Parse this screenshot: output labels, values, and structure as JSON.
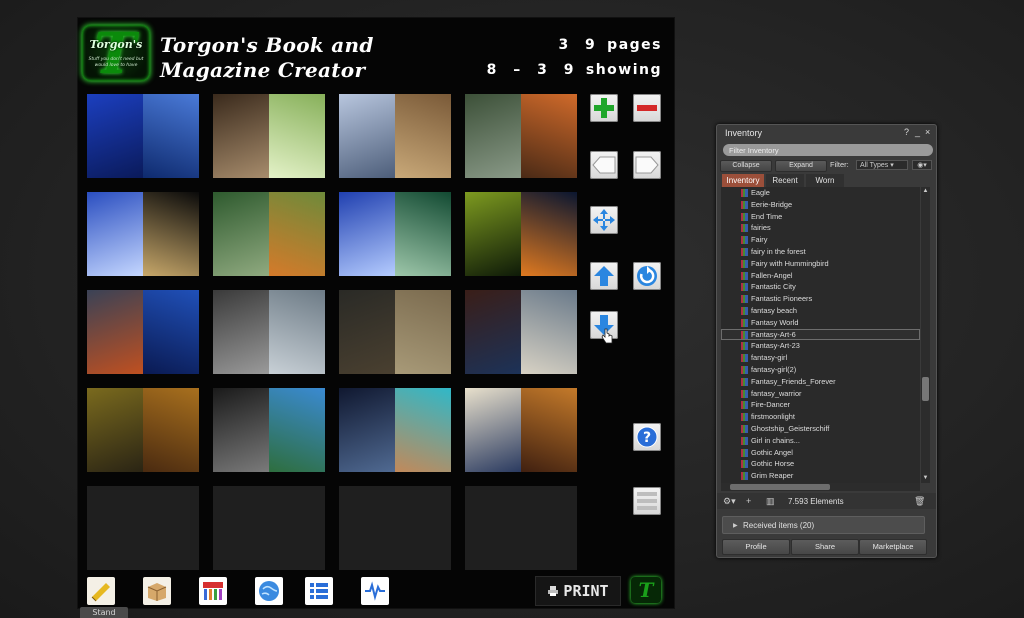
{
  "hud": {
    "logo_brand": "Torgon's",
    "logo_tagline": "Stuff you don't need but would love to have",
    "title_line1": "Torgon's Book and",
    "title_line2": "Magazine Creator",
    "pages_count": "3 9",
    "pages_label": "pages",
    "showing_range": "8 – 3 9",
    "showing_label": "showing",
    "print_label": "PRINT",
    "stand_label": "Stand",
    "side_buttons": [
      "plus-icon",
      "minus-icon",
      "left-arrow-icon",
      "right-arrow-icon",
      "expand-icon",
      "up-arrow-icon",
      "rotate-icon",
      "down-arrow-icon",
      "help-icon",
      "list-icon"
    ],
    "bottom_icons": [
      "ruler-icon",
      "box-icon",
      "color-palette-icon",
      "globe-icon",
      "settings-list-icon",
      "waveform-icon"
    ],
    "thumb_colors": [
      [
        [
          "#1c3fbf",
          "#0a1a5a"
        ],
        [
          "#4a7ad8",
          "#0e2a6e"
        ]
      ],
      [
        [
          "#3a2a1c",
          "#a78c6c"
        ],
        [
          "#87b05a",
          "#e4f2c8"
        ]
      ],
      [
        [
          "#b8c6de",
          "#4d5e7a"
        ],
        [
          "#7a5a38",
          "#c9a979"
        ]
      ],
      [
        [
          "#3c5038",
          "#8a9a88"
        ],
        [
          "#d06a2a",
          "#4a2a16"
        ]
      ],
      [
        [
          "#2a4ec0",
          "#c5d7ff"
        ],
        [
          "#0a0a0a",
          "#c8a86a"
        ]
      ],
      [
        [
          "#2e5a2e",
          "#90aa80"
        ],
        [
          "#6e8a3a",
          "#d57a2a"
        ]
      ],
      [
        [
          "#2040b0",
          "#b5ccff"
        ],
        [
          "#124a32",
          "#9ec7aa"
        ]
      ],
      [
        [
          "#7d9a20",
          "#0e1a08"
        ],
        [
          "#0a1630",
          "#e07a20"
        ]
      ],
      [
        [
          "#3a4256",
          "#c05020"
        ],
        [
          "#2050b8",
          "#0a1a52"
        ]
      ],
      [
        [
          "#3a3a3a",
          "#9a9a9a"
        ],
        [
          "#6d7b86",
          "#c8d0d6"
        ]
      ],
      [
        [
          "#2a2a26",
          "#4a4030"
        ],
        [
          "#7a6a4e",
          "#a89a78"
        ]
      ],
      [
        [
          "#3a1e18",
          "#1c3258"
        ],
        [
          "#6a7a8a",
          "#d8d2c4"
        ]
      ],
      [
        [
          "#7a6a1e",
          "#2a2414"
        ],
        [
          "#a8701e",
          "#4a2a10"
        ]
      ],
      [
        [
          "#1a1a1a",
          "#7a7a7a"
        ],
        [
          "#3a8ad2",
          "#2e6e3e"
        ]
      ],
      [
        [
          "#101830",
          "#506a92"
        ],
        [
          "#30b8c8",
          "#c2895a"
        ]
      ],
      [
        [
          "#e8e0cc",
          "#2a3a60"
        ],
        [
          "#c47a2a",
          "#402010"
        ]
      ]
    ]
  },
  "inventory": {
    "title": "Inventory",
    "help": "?",
    "minimize": "_",
    "close": "×",
    "filter_placeholder": "Filter Inventory",
    "collapse_label": "Collapse",
    "expand_label": "Expand",
    "filter_label": "Filter:",
    "type_select": "All Types",
    "view_button": "◉▾",
    "tabs": [
      "Inventory",
      "Recent",
      "Worn"
    ],
    "items": [
      "Eagle",
      "Eerie-Bridge",
      "End Time",
      "fairies",
      "Fairy",
      "fairy in the forest",
      "Fairy with Hummingbird",
      "Fallen-Angel",
      "Fantastic City",
      "Fantastic Pioneers",
      "fantasy beach",
      "Fantasy World",
      "Fantasy-Art-6",
      "Fantasy-Art-23",
      "fantasy-girl",
      "fantasy-girl(2)",
      "Fantasy_Friends_Forever",
      "fantasy_warrior",
      "Fire-Dancer",
      "firstmoonlight",
      "Ghostship_Geisterschiff",
      "Girl in chains...",
      "Gothic Angel",
      "Gothic Horse",
      "Grim Reaper"
    ],
    "selected_index": 12,
    "element_count": "7.593 Elements",
    "received_label": "Received items (20)",
    "profile_label": "Profile",
    "share_label": "Share",
    "marketplace_label": "Marketplace"
  }
}
